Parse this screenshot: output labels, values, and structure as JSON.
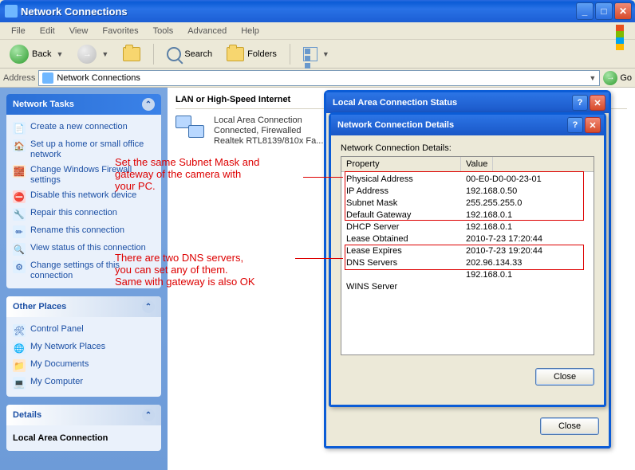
{
  "window": {
    "title": "Network Connections"
  },
  "menu": {
    "file": "File",
    "edit": "Edit",
    "view": "View",
    "favorites": "Favorites",
    "tools": "Tools",
    "advanced": "Advanced",
    "help": "Help"
  },
  "toolbar": {
    "back": "Back",
    "search": "Search",
    "folders": "Folders"
  },
  "address": {
    "label": "Address",
    "value": "Network Connections",
    "go": "Go"
  },
  "sidebar": {
    "tasks_header": "Network Tasks",
    "tasks": [
      "Create a new connection",
      "Set up a home or small office network",
      "Change Windows Firewall settings",
      "Disable this network device",
      "Repair this connection",
      "Rename this connection",
      "View status of this connection",
      "Change settings of this connection"
    ],
    "places_header": "Other Places",
    "places": [
      "Control Panel",
      "My Network Places",
      "My Documents",
      "My Computer"
    ],
    "details_header": "Details",
    "details_line": "Local Area Connection"
  },
  "content": {
    "category": "LAN or High-Speed Internet",
    "conn_name": "Local Area Connection",
    "conn_status": "Connected, Firewalled",
    "conn_device": "Realtek RTL8139/810x Fa..."
  },
  "annotations": {
    "a1": "Set the same Subnet Mask and\ngateway of the camera with\nyour PC.",
    "a2": "There are two DNS servers,\nyou can set any of them.\nSame with gateway is also OK"
  },
  "status_dlg": {
    "title": "Local Area Connection Status",
    "close": "Close"
  },
  "details_dlg": {
    "title": "Network Connection Details",
    "subtitle": "Network Connection Details:",
    "col_property": "Property",
    "col_value": "Value",
    "rows": [
      {
        "p": "Physical Address",
        "v": "00-E0-D0-00-23-01"
      },
      {
        "p": "IP Address",
        "v": "192.168.0.50"
      },
      {
        "p": "Subnet Mask",
        "v": "255.255.255.0"
      },
      {
        "p": "Default Gateway",
        "v": "192.168.0.1"
      },
      {
        "p": "DHCP Server",
        "v": "192.168.0.1"
      },
      {
        "p": "Lease Obtained",
        "v": "2010-7-23 17:20:44"
      },
      {
        "p": "Lease Expires",
        "v": "2010-7-23 19:20:44"
      },
      {
        "p": "DNS Servers",
        "v": "202.96.134.33"
      },
      {
        "p": "",
        "v": "192.168.0.1"
      },
      {
        "p": "WINS Server",
        "v": ""
      }
    ],
    "close": "Close"
  }
}
